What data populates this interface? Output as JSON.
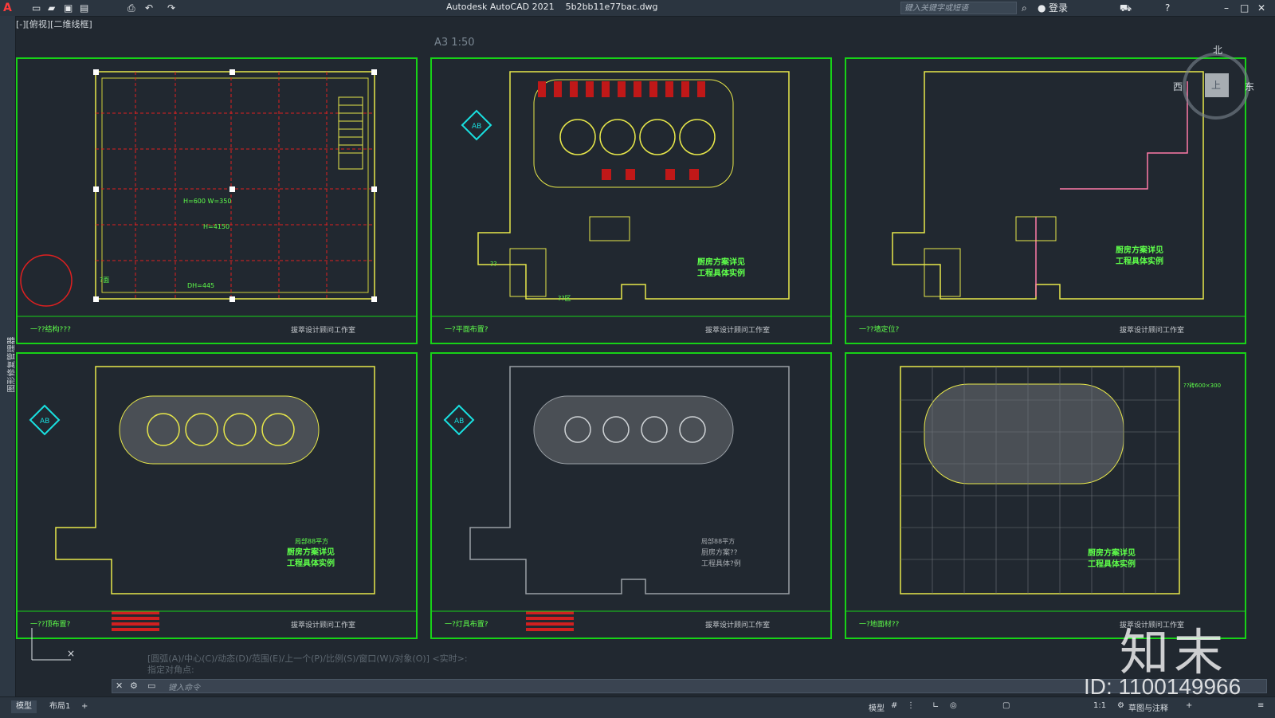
{
  "titlebar": {
    "app_title": "Autodesk AutoCAD 2021",
    "file_name": "5b2bb11e77bac.dwg",
    "search_placeholder": "键入关键字或短语",
    "login_label": "登录"
  },
  "viewport": {
    "view_label": "[-][俯视][二维线框]",
    "scale_label": "A3  1:50"
  },
  "palette": {
    "label": "图形修复管理器"
  },
  "viewcube": {
    "north": "北",
    "west": "西",
    "east": "东",
    "center": "上"
  },
  "sheets": [
    {
      "caption": "一??结构???",
      "stamp": "拔萃设计顾问工作室",
      "notes": [
        "H=600 W=350",
        "H=4150",
        "DH=445",
        "?面"
      ]
    },
    {
      "caption": "一?平面布置?",
      "stamp": "拔萃设计顾问工作室",
      "notes": [
        "厨房方案详见",
        "工程具体实例",
        "??",
        "??区"
      ]
    },
    {
      "caption": "一??墙定位?",
      "stamp": "拔萃设计顾问工作室",
      "notes": [
        "厨房方案详见",
        "工程具体实例"
      ]
    },
    {
      "caption": "一??顶布置?",
      "stamp": "拔萃设计顾问工作室",
      "notes": [
        "局部88平方",
        "厨房方案详见",
        "工程具体实例"
      ]
    },
    {
      "caption": "一?灯具布置?",
      "stamp": "拔萃设计顾问工作室",
      "notes": [
        "局部88平方",
        "厨房方案??",
        "工程具体?例"
      ]
    },
    {
      "caption": "一?地面材??",
      "stamp": "拔萃设计顾问工作室",
      "notes": [
        "厨房方案详见",
        "工程具体实例",
        "??砖600×300"
      ]
    }
  ],
  "command": {
    "history_line_1": "[圆弧(A)/中心(C)/动态(D)/范围(E)/上一个(P)/比例(S)/窗口(W)/对象(O)] <实时>:",
    "history_line_2": "指定对角点:",
    "input_placeholder": "键入命令"
  },
  "statusbar": {
    "tabs": [
      "模型",
      "布局1",
      "+"
    ],
    "model_label": "模型",
    "scale": "1:1",
    "workspace": "草图与注释"
  },
  "watermark": {
    "logo": "知末",
    "id_text": "ID: 1100149966"
  },
  "colors": {
    "background": "#212830",
    "frame_green": "#17d217",
    "wall_yellow": "#e8e84a",
    "text_green": "#5eff4a",
    "axis_red": "#ff3030",
    "cyan": "#19e0e0"
  }
}
